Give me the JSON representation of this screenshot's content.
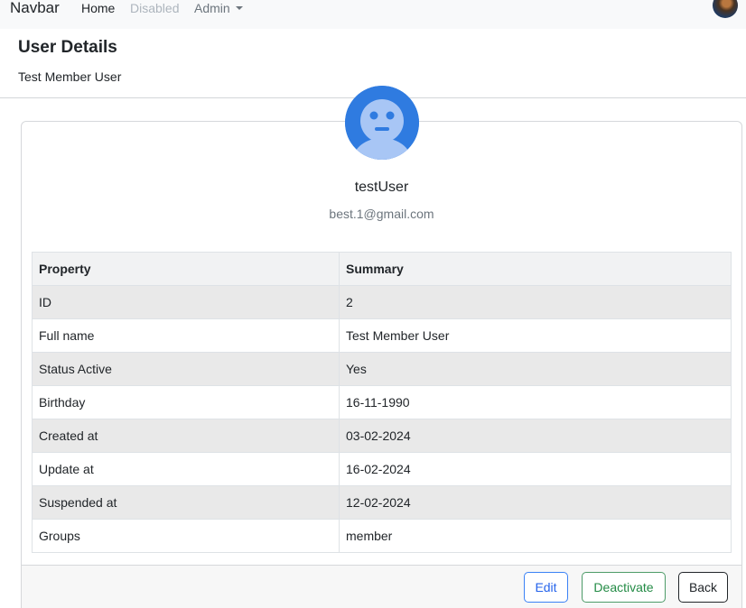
{
  "navbar": {
    "brand": "Navbar",
    "links": [
      {
        "label": "Home",
        "state": "active"
      },
      {
        "label": "Disabled",
        "state": "disabled"
      },
      {
        "label": "Admin",
        "state": "dropdown"
      }
    ]
  },
  "page": {
    "title": "User Details",
    "subtitle": "Test Member User"
  },
  "profile": {
    "username": "testUser",
    "email": "best.1@gmail.com",
    "avatar_icon": "user-face-icon"
  },
  "table": {
    "headers": [
      "Property",
      "Summary"
    ],
    "rows": [
      [
        "ID",
        "2"
      ],
      [
        "Full name",
        "Test Member User"
      ],
      [
        "Status Active",
        "Yes"
      ],
      [
        "Birthday",
        "16-11-1990"
      ],
      [
        "Created at",
        "03-02-2024"
      ],
      [
        "Update at",
        "16-02-2024"
      ],
      [
        "Suspended at",
        "12-02-2024"
      ],
      [
        "Groups",
        "member"
      ]
    ]
  },
  "actions": {
    "edit_label": "Edit",
    "deactivate_label": "Deactivate",
    "back_label": "Back"
  },
  "colors": {
    "primary": "#2563eb",
    "success": "#238b45",
    "avatar_bg": "#2f7be0",
    "avatar_face": "#a8c6f5"
  }
}
